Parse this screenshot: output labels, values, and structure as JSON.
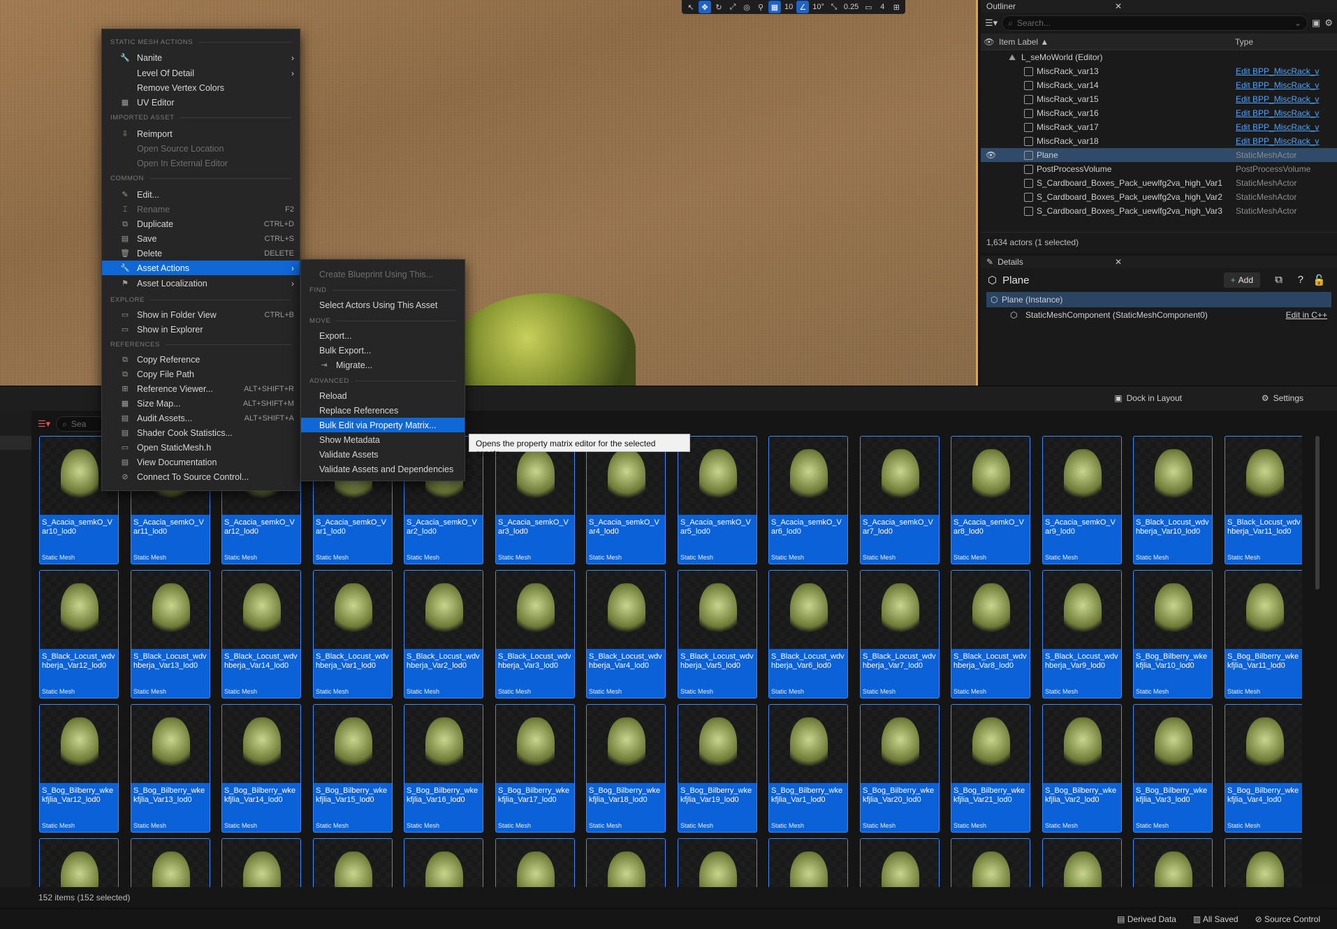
{
  "viewport_toolbar": {
    "grid": "10",
    "angle": "10°",
    "scale": "0.25",
    "camera": "4"
  },
  "outliner": {
    "tab": "Outliner",
    "search_placeholder": "Search...",
    "col_label": "Item Label ▲",
    "col_type": "Type",
    "world": "L_seMoWorld (Editor)",
    "rows": [
      {
        "label": "MiscRack_var13",
        "type": "Edit BPP_MiscRack_v"
      },
      {
        "label": "MiscRack_var14",
        "type": "Edit BPP_MiscRack_v"
      },
      {
        "label": "MiscRack_var15",
        "type": "Edit BPP_MiscRack_v"
      },
      {
        "label": "MiscRack_var16",
        "type": "Edit BPP_MiscRack_v"
      },
      {
        "label": "MiscRack_var17",
        "type": "Edit BPP_MiscRack_v"
      },
      {
        "label": "MiscRack_var18",
        "type": "Edit BPP_MiscRack_v"
      },
      {
        "label": "Plane",
        "type": "StaticMeshActor"
      },
      {
        "label": "PostProcessVolume",
        "type": "PostProcessVolume"
      },
      {
        "label": "S_Cardboard_Boxes_Pack_uewlfg2va_high_Var1",
        "type": "StaticMeshActor"
      },
      {
        "label": "S_Cardboard_Boxes_Pack_uewlfg2va_high_Var2",
        "type": "StaticMeshActor"
      },
      {
        "label": "S_Cardboard_Boxes_Pack_uewlfg2va_high_Var3",
        "type": "StaticMeshActor"
      }
    ],
    "footer": "1,634 actors (1 selected)"
  },
  "details": {
    "tab": "Details",
    "title": "Plane",
    "add": "Add",
    "instance": "Plane (Instance)",
    "component": "StaticMeshComponent (StaticMeshComponent0)",
    "edit_cpp": "Edit in C++"
  },
  "cb": {
    "dock": "Dock in Layout",
    "settings": "Settings",
    "search_placeholder": "Sea",
    "footer": "152 items (152 selected)"
  },
  "status": {
    "derived": "Derived Data",
    "saved": "All Saved",
    "source": "Source Control"
  },
  "menu": {
    "sec_static": "STATIC MESH ACTIONS",
    "nanite": "Nanite",
    "lod": "Level Of Detail",
    "remove_vc": "Remove Vertex Colors",
    "uv": "UV Editor",
    "sec_imported": "IMPORTED ASSET",
    "reimport": "Reimport",
    "open_src": "Open Source Location",
    "open_ext": "Open In External Editor",
    "sec_common": "COMMON",
    "edit": "Edit...",
    "rename": "Rename",
    "rename_sc": "F2",
    "duplicate": "Duplicate",
    "duplicate_sc": "CTRL+D",
    "save": "Save",
    "save_sc": "CTRL+S",
    "delete": "Delete",
    "delete_sc": "DELETE",
    "asset_actions": "Asset Actions",
    "asset_loc": "Asset Localization",
    "sec_explore": "EXPLORE",
    "show_folder": "Show in Folder View",
    "show_folder_sc": "CTRL+B",
    "show_explorer": "Show in Explorer",
    "sec_refs": "REFERENCES",
    "copy_ref": "Copy Reference",
    "copy_path": "Copy File Path",
    "ref_viewer": "Reference Viewer...",
    "ref_viewer_sc": "ALT+SHIFT+R",
    "size_map": "Size Map...",
    "size_map_sc": "ALT+SHIFT+M",
    "audit": "Audit Assets...",
    "audit_sc": "ALT+SHIFT+A",
    "shader": "Shader Cook Statistics...",
    "open_h": "Open StaticMesh.h",
    "view_doc": "View Documentation",
    "connect_sc": "Connect To Source Control..."
  },
  "submenu": {
    "create_bp": "Create Blueprint Using This...",
    "sec_find": "FIND",
    "select_actors": "Select Actors Using This Asset",
    "sec_move": "MOVE",
    "export": "Export...",
    "bulk_export": "Bulk Export...",
    "migrate": "Migrate...",
    "sec_adv": "ADVANCED",
    "reload": "Reload",
    "replace": "Replace References",
    "bulk_edit": "Bulk Edit via Property Matrix...",
    "show_meta": "Show Metadata",
    "validate": "Validate Assets",
    "validate_dep": "Validate Assets and Dependencies"
  },
  "tooltip": "Opens the property matrix editor for the selected assets.",
  "assets": {
    "type_label": "Static Mesh",
    "row1": [
      "S_Acacia_semkO_Var10_lod0",
      "S_Acacia_semkO_Var11_lod0",
      "S_Acacia_semkO_Var12_lod0",
      "S_Acacia_semkO_Var1_lod0",
      "S_Acacia_semkO_Var2_lod0",
      "S_Acacia_semkO_Var3_lod0",
      "S_Acacia_semkO_Var4_lod0",
      "S_Acacia_semkO_Var5_lod0",
      "S_Acacia_semkO_Var6_lod0",
      "S_Acacia_semkO_Var7_lod0",
      "S_Acacia_semkO_Var8_lod0",
      "S_Acacia_semkO_Var9_lod0",
      "S_Black_Locust_wdvhberja_Var10_lod0",
      "S_Black_Locust_wdvhberja_Var11_lod0"
    ],
    "row2": [
      "S_Black_Locust_wdvhberja_Var12_lod0",
      "S_Black_Locust_wdvhberja_Var13_lod0",
      "S_Black_Locust_wdvhberja_Var14_lod0",
      "S_Black_Locust_wdvhberja_Var1_lod0",
      "S_Black_Locust_wdvhberja_Var2_lod0",
      "S_Black_Locust_wdvhberja_Var3_lod0",
      "S_Black_Locust_wdvhberja_Var4_lod0",
      "S_Black_Locust_wdvhberja_Var5_lod0",
      "S_Black_Locust_wdvhberja_Var6_lod0",
      "S_Black_Locust_wdvhberja_Var7_lod0",
      "S_Black_Locust_wdvhberja_Var8_lod0",
      "S_Black_Locust_wdvhberja_Var9_lod0",
      "S_Bog_Bilberry_wkekfjlia_Var10_lod0",
      "S_Bog_Bilberry_wkekfjlia_Var11_lod0"
    ],
    "row3": [
      "S_Bog_Bilberry_wkekfjlia_Var12_lod0",
      "S_Bog_Bilberry_wkekfjlia_Var13_lod0",
      "S_Bog_Bilberry_wkekfjlia_Var14_lod0",
      "S_Bog_Bilberry_wkekfjlia_Var15_lod0",
      "S_Bog_Bilberry_wkekfjlia_Var16_lod0",
      "S_Bog_Bilberry_wkekfjlia_Var17_lod0",
      "S_Bog_Bilberry_wkekfjlia_Var18_lod0",
      "S_Bog_Bilberry_wkekfjlia_Var19_lod0",
      "S_Bog_Bilberry_wkekfjlia_Var1_lod0",
      "S_Bog_Bilberry_wkekfjlia_Var20_lod0",
      "S_Bog_Bilberry_wkekfjlia_Var21_lod0",
      "S_Bog_Bilberry_wkekfjlia_Var2_lod0",
      "S_Bog_Bilberry_wkekfjlia_Var3_lod0",
      "S_Bog_Bilberry_wkekfjlia_Var4_lod0"
    ]
  }
}
